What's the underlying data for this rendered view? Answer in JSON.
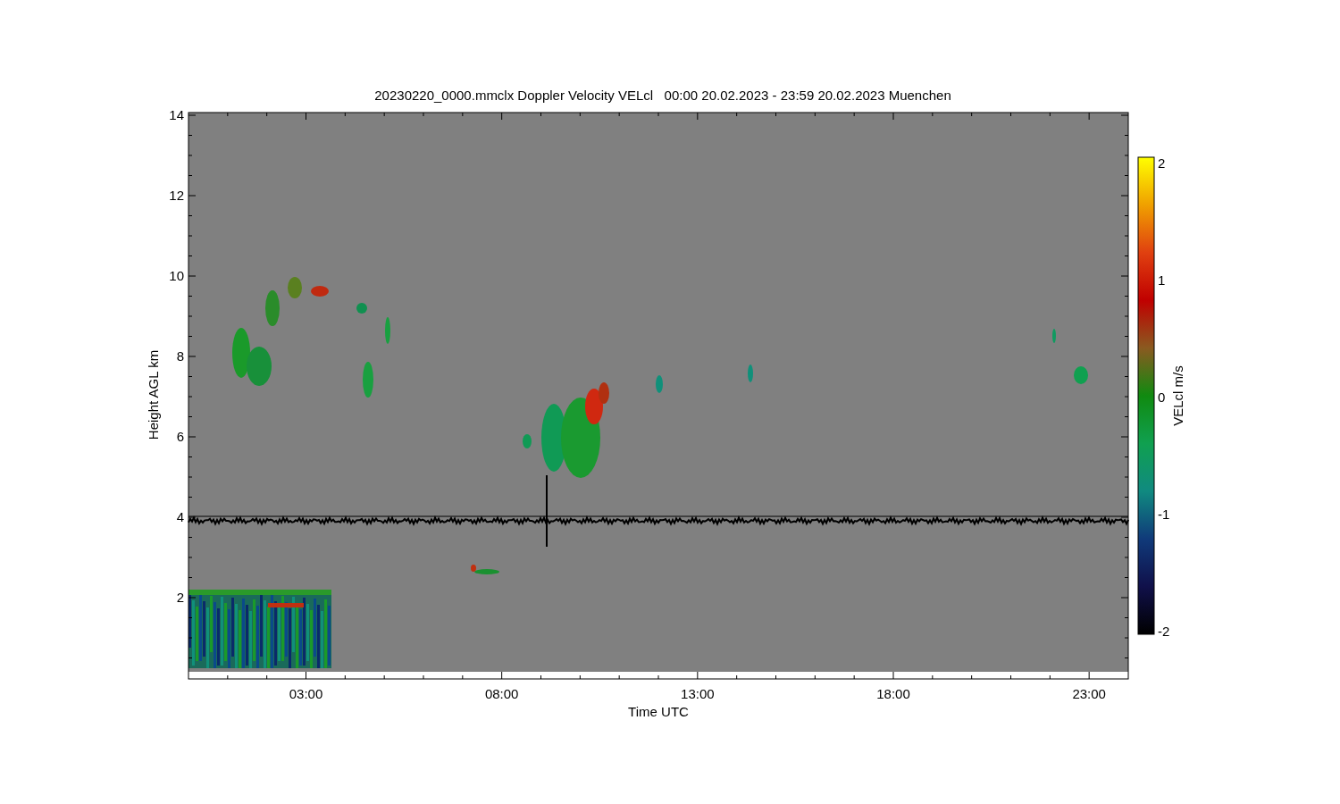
{
  "figure": {
    "title": "20230220_0000.mmclx Doppler Velocity VELcl   00:00 20.02.2023 - 23:59 20.02.2023 Muenchen",
    "x_axis": {
      "label": "Time UTC",
      "ticks": [
        "03:00",
        "08:00",
        "13:00",
        "18:00",
        "23:00"
      ]
    },
    "y_axis": {
      "label": "Height AGL km",
      "ticks": [
        "14",
        "12",
        "10",
        "8",
        "6",
        "4",
        "2"
      ]
    },
    "colorbar": {
      "label": "VELcl m/s",
      "ticks": [
        "2",
        "1",
        "0",
        "-1",
        "-2"
      ]
    }
  }
}
